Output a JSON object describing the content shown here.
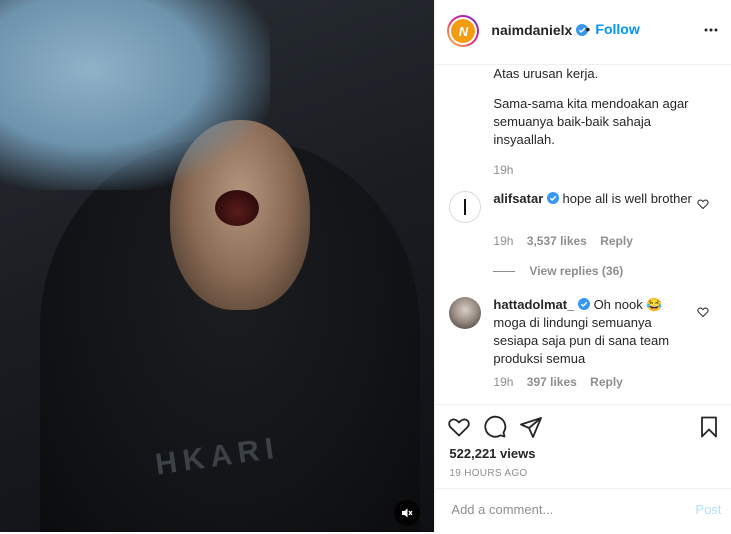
{
  "header": {
    "username": "naimdanielx",
    "avatar_letter": "N",
    "dot": "•",
    "follow_label": "Follow"
  },
  "caption": {
    "line1": "Atas urusan kerja.",
    "line2": "Sama-sama kita mendoakan agar semuanya baik-baik sahaja insyaallah.",
    "time": "19h"
  },
  "comments": [
    {
      "username": "alifsatar",
      "text": "hope all is well brother",
      "time": "19h",
      "likes": "3,537 likes",
      "reply_label": "Reply",
      "view_replies": "View replies (36)"
    },
    {
      "username": "hattadolmat_",
      "text": "Oh nook 😂 moga di lindungi semuanya sesiapa saja pun di sana team produksi semua",
      "time": "19h",
      "likes": "397 likes",
      "reply_label": "Reply"
    }
  ],
  "stats": {
    "views": "522,221 views",
    "date": "19 HOURS AGO"
  },
  "add_comment": {
    "placeholder": "Add a comment...",
    "post_label": "Post"
  },
  "media": {
    "shirt_text": "HKARI"
  },
  "colors": {
    "accent": "#0095f6",
    "muted": "#8e8e8e",
    "text": "#262626",
    "post_disabled": "#b2dffc"
  }
}
